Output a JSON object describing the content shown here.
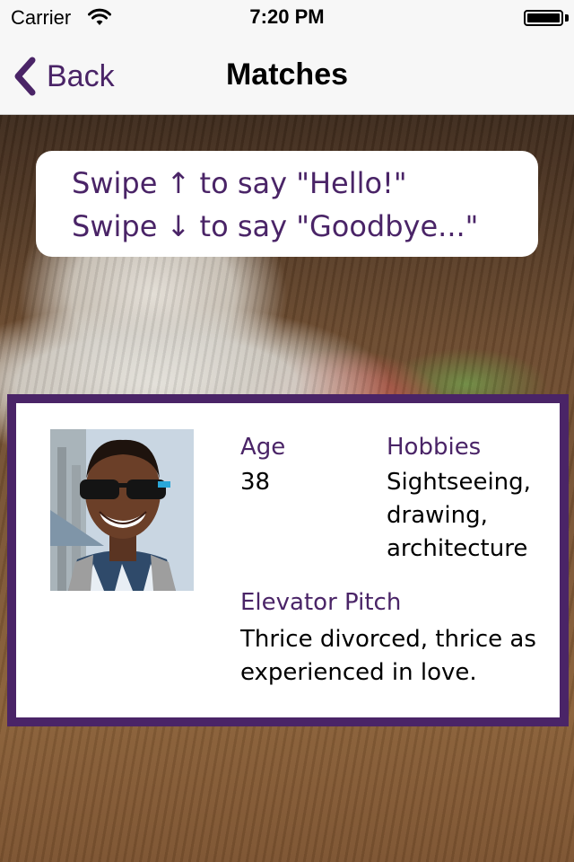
{
  "status_bar": {
    "carrier": "Carrier",
    "time": "7:20 PM",
    "wifi_icon": "wifi-icon",
    "battery_icon": "battery-icon"
  },
  "nav": {
    "back_label": "Back",
    "title": "Matches",
    "back_icon": "chevron-left-icon"
  },
  "instructions": {
    "line1": "Swipe ↑ to say \"Hello!\"",
    "line2": "Swipe ↓ to say \"Goodbye...\""
  },
  "profile": {
    "age_label": "Age",
    "age_value": "38",
    "hobbies_label": "Hobbies",
    "hobbies_value": "Sightseeing, drawing, architecture",
    "pitch_label": "Elevator Pitch",
    "pitch_value": "Thrice divorced, thrice as experienced in love."
  },
  "colors": {
    "accent": "#4a2467",
    "bar_background": "#f7f7f7",
    "card_background": "#ffffff"
  }
}
